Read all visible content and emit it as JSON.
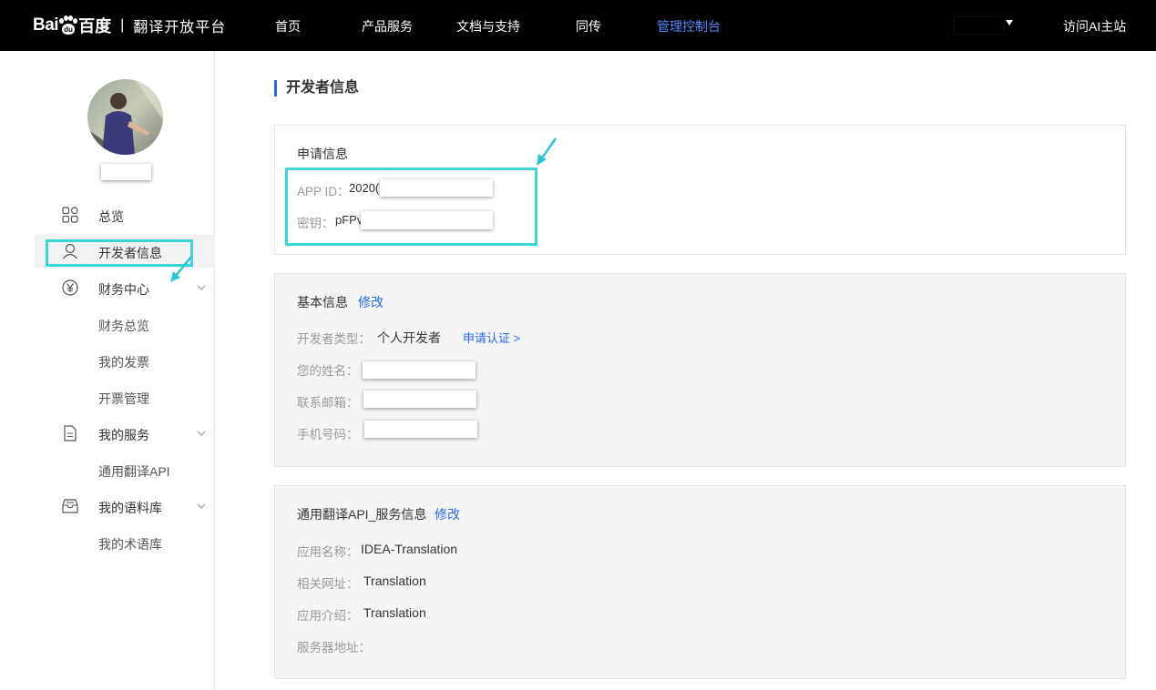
{
  "header": {
    "logo_bai": "Bai",
    "logo_du": "du",
    "logo_baidu": "百度",
    "logo_sep": "|",
    "product_title": "翻译开放平台",
    "nav": [
      {
        "label": "首页"
      },
      {
        "label": "产品服务"
      },
      {
        "label": "文档与支持"
      },
      {
        "label": "同传"
      },
      {
        "label": "管理控制台",
        "active": true
      }
    ],
    "visit_ai": "访问AI主站",
    "active_color": "#4e8cff"
  },
  "sidebar": {
    "items": [
      {
        "label": "总览",
        "icon": "grid-icon"
      },
      {
        "label": "开发者信息",
        "icon": "user-icon",
        "active": true
      },
      {
        "label": "财务中心",
        "icon": "yen-icon",
        "expandable": true
      },
      {
        "label": "财务总览"
      },
      {
        "label": "我的发票"
      },
      {
        "label": "开票管理"
      },
      {
        "label": "我的服务",
        "icon": "document-icon",
        "expandable": true
      },
      {
        "label": "通用翻译API"
      },
      {
        "label": "我的语料库",
        "icon": "inbox-icon",
        "expandable": true
      },
      {
        "label": "我的术语库"
      }
    ]
  },
  "main": {
    "title": "开发者信息",
    "apply_info": {
      "title": "申请信息",
      "app_id_label": "APP ID：",
      "app_id_value": "2020(",
      "secret_label": "密钥：",
      "secret_value": "pFPv"
    },
    "basic_info": {
      "title": "基本信息",
      "edit": "修改",
      "dev_type_label": "开发者类型：",
      "dev_type_value": "个人开发者",
      "apply_cert": "申请认证 >",
      "name_label": "您的姓名：",
      "email_label": "联系邮箱：",
      "phone_label": "手机号码："
    },
    "service_info": {
      "title": "通用翻译API_服务信息",
      "edit": "修改",
      "app_name_label": "应用名称：",
      "app_name_value": "IDEA-Translation",
      "url_label": "相关网址：",
      "url_value": "Translation",
      "desc_label": "应用介绍：",
      "desc_value": "Translation",
      "server_label": "服务器地址："
    }
  },
  "colors": {
    "accent": "#2468f2",
    "highlight": "#3cd6d6"
  }
}
